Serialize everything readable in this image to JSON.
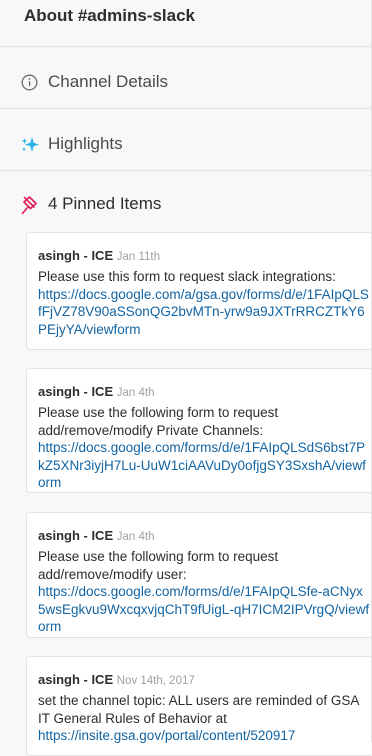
{
  "header": {
    "title": "About #admins-slack"
  },
  "sections": {
    "channel_details": {
      "label": "Channel Details",
      "icon": "info-circle-icon"
    },
    "highlights": {
      "label": "Highlights",
      "icon": "sparkle-icon"
    },
    "pinned": {
      "label": "4 Pinned Items",
      "icon": "pin-icon",
      "accent": "#e01e5a"
    }
  },
  "pinned_items": [
    {
      "author": "asingh - ICE",
      "time": "Jan 11th",
      "text": "Please use this form to request slack integrations:",
      "link": "https://docs.google.com/a/gsa.gov/forms/d/e/1FAIpQLSfFjVZ78V90aSSonQG2bvMTn-yrw9a9JXTrRRCZTkY6PEjyYA/viewform"
    },
    {
      "author": "asingh - ICE",
      "time": "Jan 4th",
      "text": "Please use the following form to request add/remove/modify Private Channels:",
      "link": "https://docs.google.com/forms/d/e/1FAIpQLSdS6bst7PkZ5XNr3iyjH7Lu-UuW1ciAAVuDy0ofjgSY3SxshA/viewform"
    },
    {
      "author": "asingh - ICE",
      "time": "Jan 4th",
      "text": "Please use the following form to request add/remove/modify user:",
      "link": "https://docs.google.com/forms/d/e/1FAIpQLSfe-aCNyx5wsEgkvu9WxcqxvjqChT9fUigL-qH7ICM2IPVrgQ/viewform"
    },
    {
      "author": "asingh - ICE",
      "time": "Nov 14th, 2017",
      "text": "set the channel topic: ALL users are reminded of GSA IT General Rules of Behavior at",
      "link": "https://insite.gsa.gov/portal/content/520917"
    }
  ],
  "colors": {
    "link": "#1264a3",
    "pin": "#e01e5a",
    "sparkle": "#2eb3e6"
  }
}
